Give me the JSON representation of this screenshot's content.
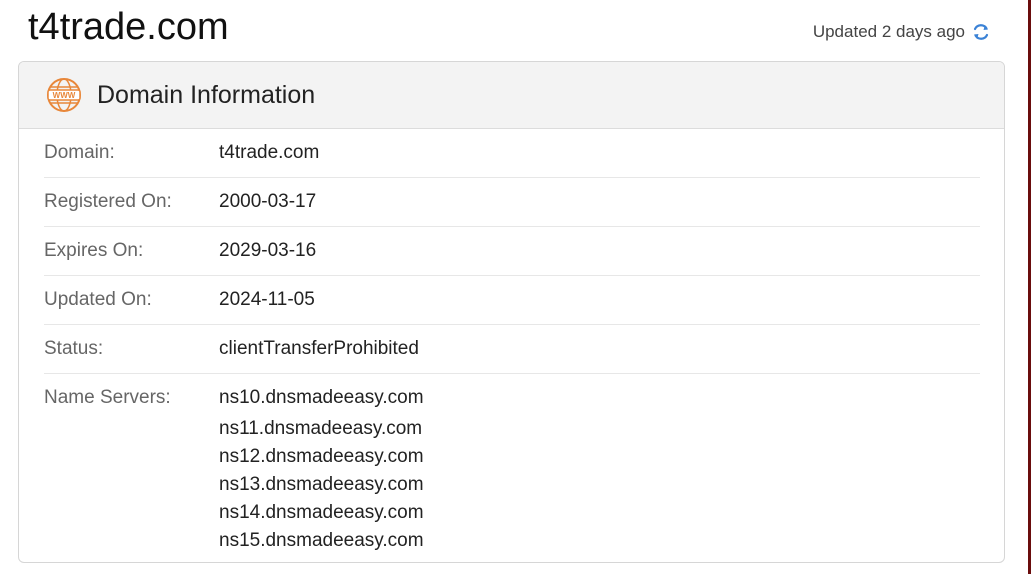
{
  "page": {
    "title": "t4trade.com",
    "updated_text": "Updated 2 days ago"
  },
  "card": {
    "title": "Domain Information",
    "icon": "www-globe-icon",
    "rows": [
      {
        "label": "Domain:",
        "value": "t4trade.com"
      },
      {
        "label": "Registered On:",
        "value": "2000-03-17"
      },
      {
        "label": "Expires On:",
        "value": "2029-03-16"
      },
      {
        "label": "Updated On:",
        "value": "2024-11-05"
      },
      {
        "label": "Status:",
        "value": "clientTransferProhibited"
      }
    ],
    "name_servers": {
      "label": "Name Servers:",
      "values": [
        "ns10.dnsmadeeasy.com",
        "ns11.dnsmadeeasy.com",
        "ns12.dnsmadeeasy.com",
        "ns13.dnsmadeeasy.com",
        "ns14.dnsmadeeasy.com",
        "ns15.dnsmadeeasy.com"
      ]
    }
  },
  "colors": {
    "accent_orange": "#e8873a",
    "refresh_blue": "#3b82d6"
  }
}
